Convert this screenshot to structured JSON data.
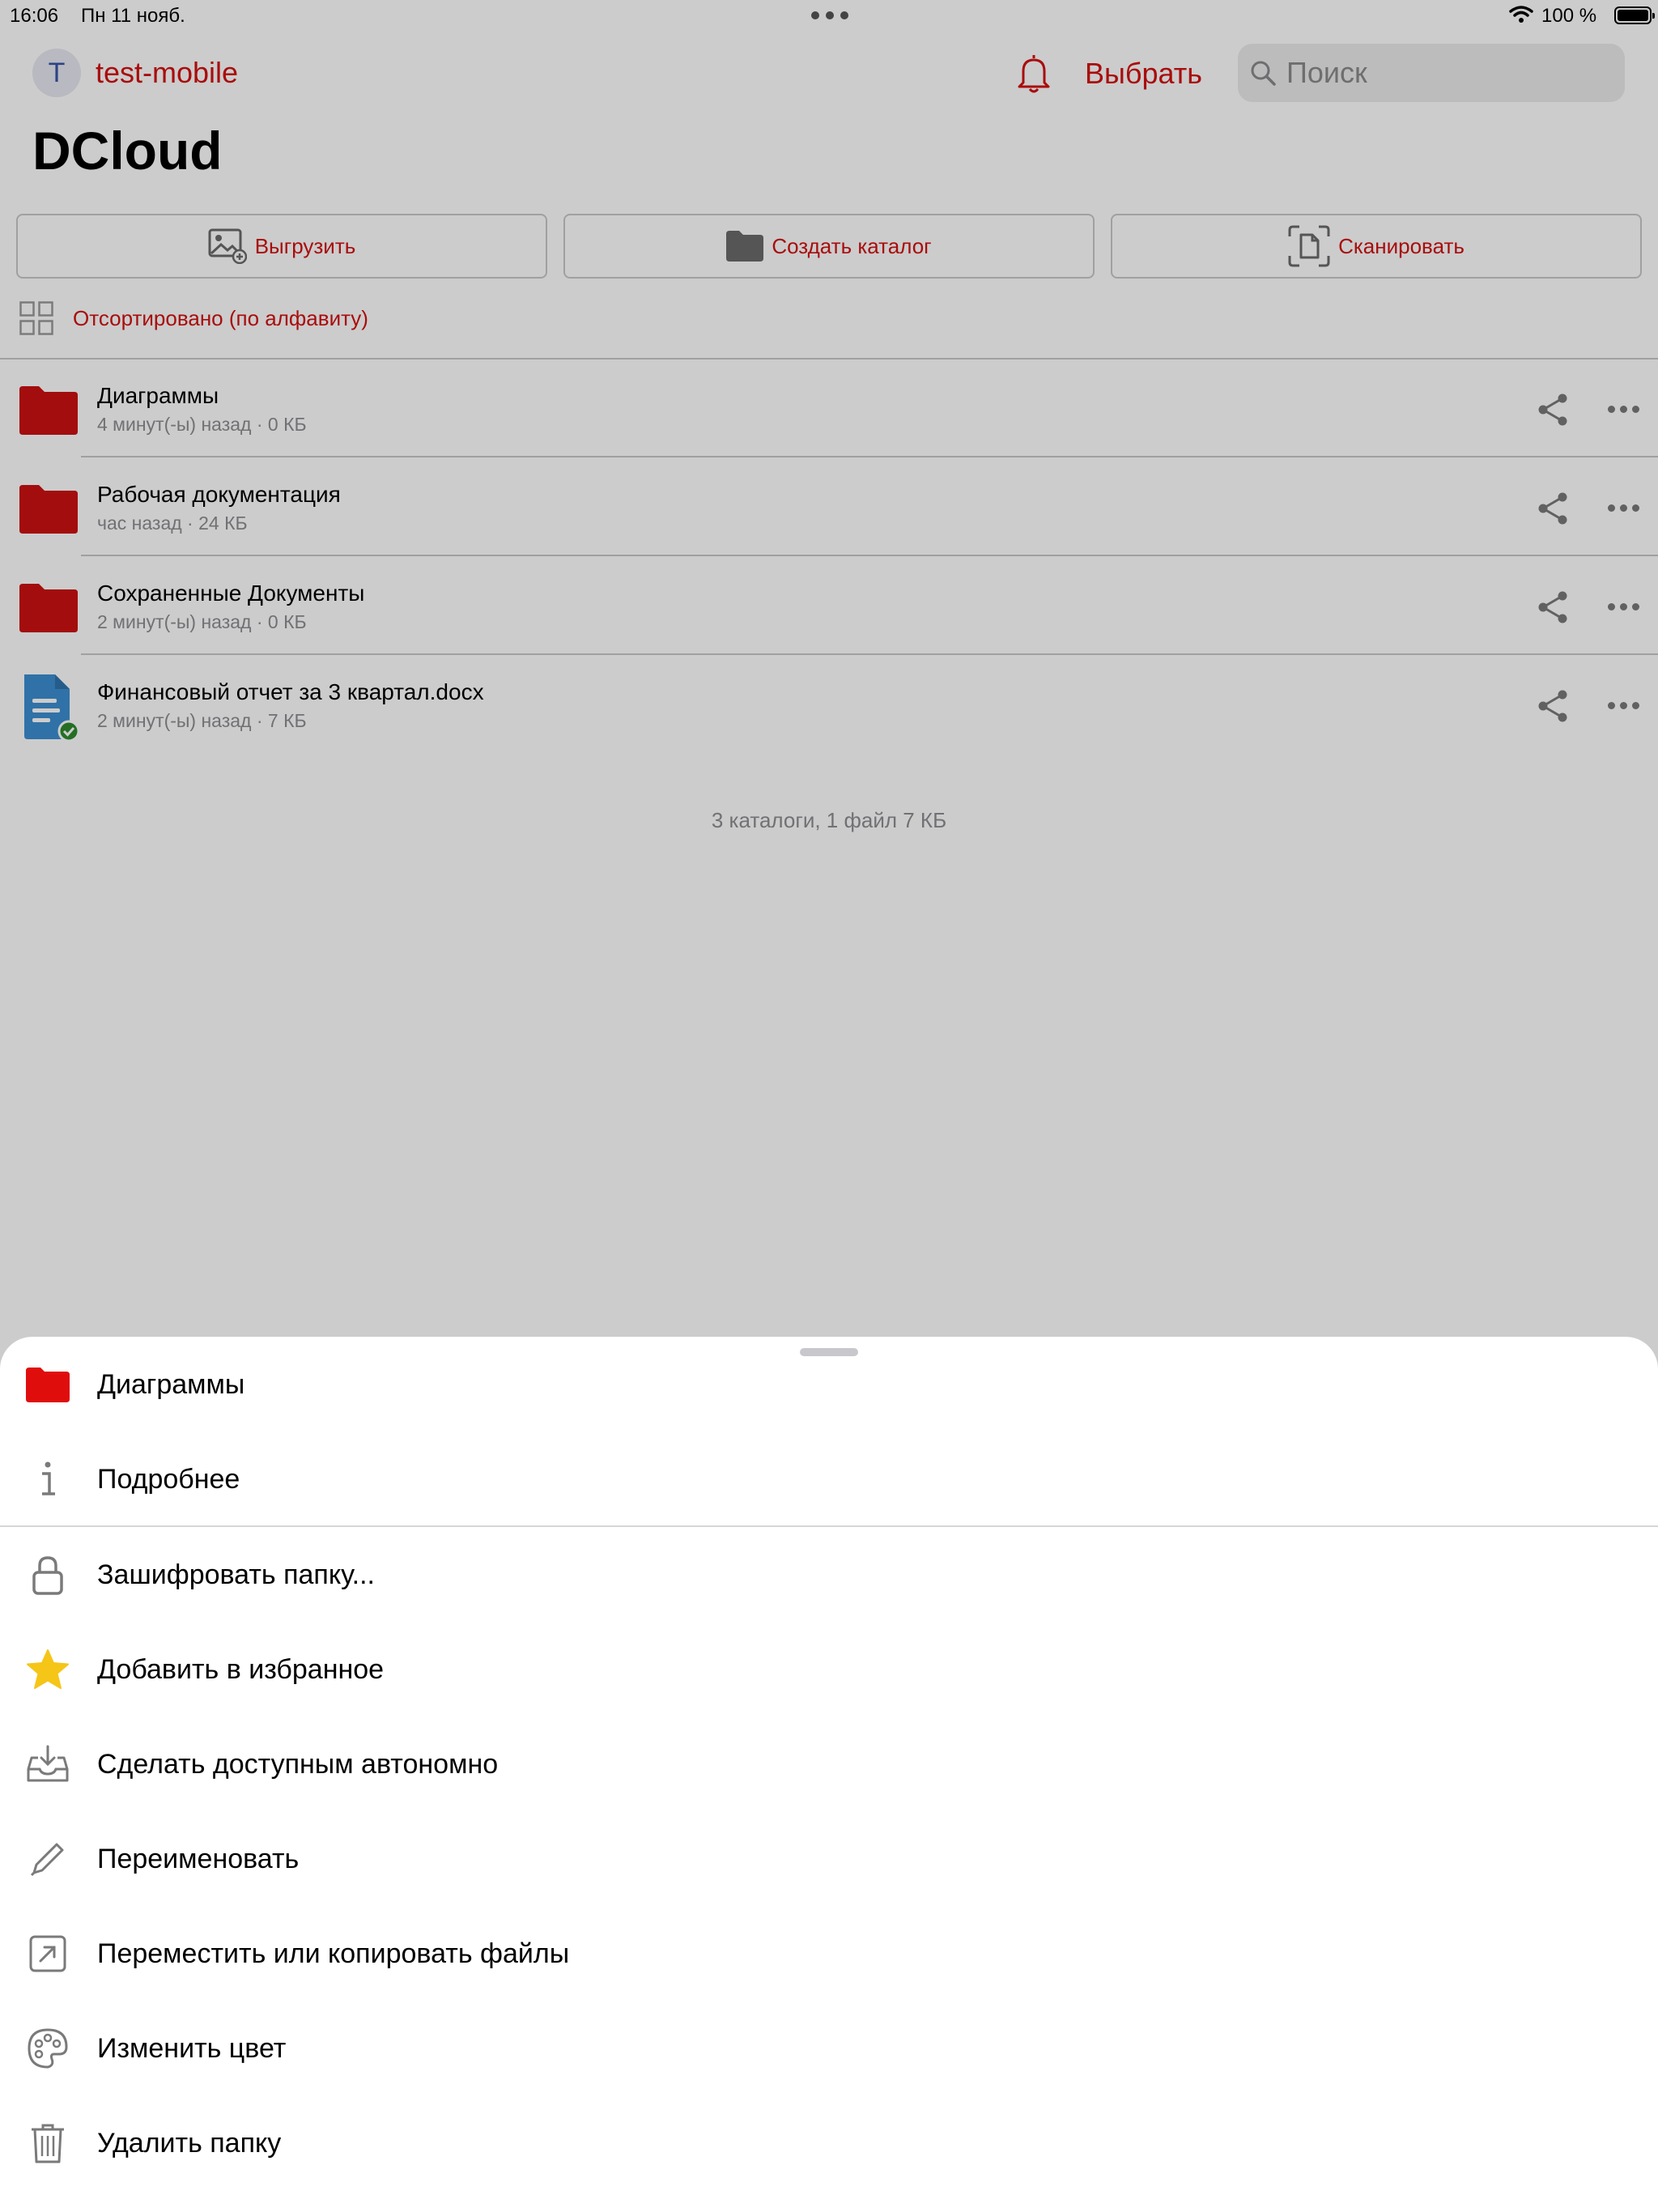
{
  "status_bar": {
    "time": "16:06",
    "date": "Пн 11 нояб.",
    "battery_percent": "100 %"
  },
  "header": {
    "avatar_letter": "T",
    "account_name": "test-mobile",
    "select_label": "Выбрать",
    "search_placeholder": "Поиск",
    "search_value": ""
  },
  "page": {
    "title": "DCloud"
  },
  "toolbar": {
    "upload_label": "Выгрузить",
    "create_folder_label": "Создать каталог",
    "scan_label": "Сканировать"
  },
  "sort": {
    "label": "Отсортировано (по алфавиту)"
  },
  "files": [
    {
      "name": "Диаграммы",
      "meta": "4 минут(-ы) назад · 0 КБ",
      "type": "folder"
    },
    {
      "name": "Рабочая документация",
      "meta": "час назад · 24 КБ",
      "type": "folder"
    },
    {
      "name": "Сохраненные Документы",
      "meta": "2 минут(-ы) назад · 0 КБ",
      "type": "folder"
    },
    {
      "name": "Финансовый отчет за 3 квартал.docx",
      "meta": "2 минут(-ы) назад · 7 КБ",
      "type": "document",
      "synced": true
    }
  ],
  "summary": "3 каталоги, 1 файл 7 КБ",
  "action_sheet": {
    "folder_name": "Диаграммы",
    "items": [
      {
        "label": "Подробнее",
        "icon": "info-icon"
      },
      {
        "label": "Зашифровать папку...",
        "icon": "lock-icon"
      },
      {
        "label": "Добавить в избранное",
        "icon": "star-icon"
      },
      {
        "label": "Сделать доступным автономно",
        "icon": "offline-download-icon"
      },
      {
        "label": "Переименовать",
        "icon": "pencil-icon"
      },
      {
        "label": "Переместить или копировать файлы",
        "icon": "move-icon"
      },
      {
        "label": "Изменить цвет",
        "icon": "palette-icon"
      },
      {
        "label": "Удалить папку",
        "icon": "trash-icon"
      }
    ]
  },
  "colors": {
    "accent": "#d40f0f",
    "folder": "#cc1111",
    "document": "#3d8fd1",
    "synced_badge": "#2e8b2e",
    "star": "#f5c518"
  }
}
